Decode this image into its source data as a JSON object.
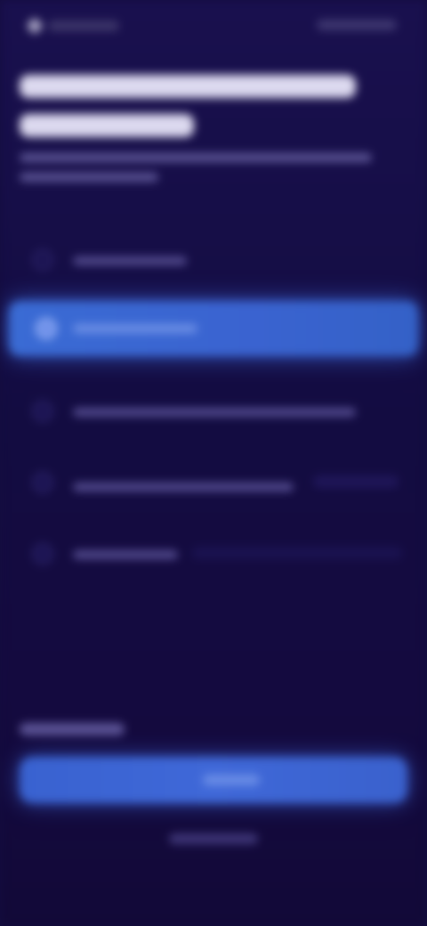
{
  "header": {
    "back_icon": "arrow-left-icon"
  },
  "options": {
    "selected_index": 1
  },
  "colors": {
    "background": "#140d3f",
    "accent": "#3a65d2",
    "muted_text": "#5a5393"
  }
}
